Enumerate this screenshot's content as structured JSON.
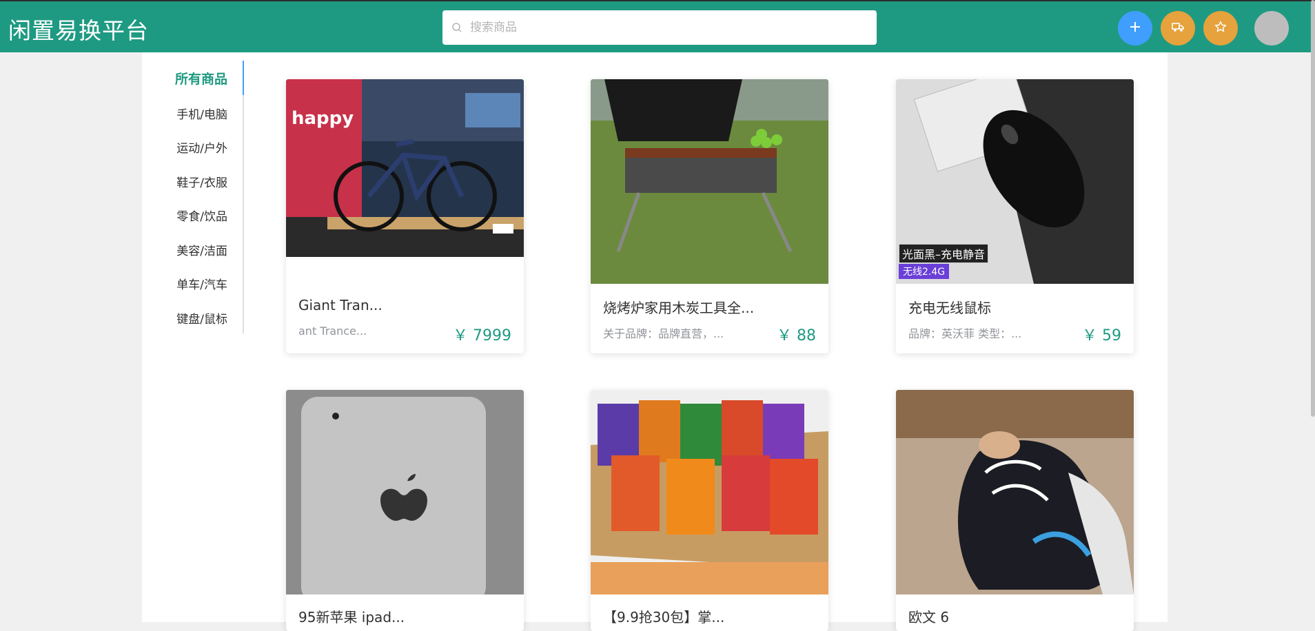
{
  "header": {
    "site_title": "闲置易换平台",
    "search_placeholder": "搜索商品",
    "buttons": [
      {
        "name": "add-item-button",
        "icon": "plus-icon",
        "color": "#409eff"
      },
      {
        "name": "orders-button",
        "icon": "truck-icon",
        "color": "#e6a23c"
      },
      {
        "name": "favorites-button",
        "icon": "star-icon",
        "color": "#e6a23c"
      }
    ],
    "accent_color": "#1f9a82"
  },
  "sidebar": {
    "items": [
      {
        "label": "所有商品",
        "active": true
      },
      {
        "label": "手机/电脑",
        "active": false
      },
      {
        "label": "运动/户外",
        "active": false
      },
      {
        "label": "鞋子/衣服",
        "active": false
      },
      {
        "label": "零食/饮品",
        "active": false
      },
      {
        "label": "美容/洁面",
        "active": false
      },
      {
        "label": "单车/汽车",
        "active": false
      },
      {
        "label": "键盘/鼠标",
        "active": false
      }
    ]
  },
  "products": [
    {
      "title": "Giant Tran...",
      "desc": "ant Trance...",
      "price": "￥ 7999",
      "image": "bicycle-image",
      "overlay_tags": []
    },
    {
      "title": "烧烤炉家用木炭工具全...",
      "desc": "关于品牌：品牌直营，...",
      "price": "￥ 88",
      "image": "bbq-grill-image",
      "overlay_tags": []
    },
    {
      "title": "充电无线鼠标",
      "desc": "品牌：英沃菲 类型：...",
      "price": "￥ 59",
      "image": "wireless-mouse-image",
      "overlay_tags": [
        "光面黑–充电静音",
        "无线2.4G"
      ]
    },
    {
      "title": "95新苹果 ipad...",
      "desc": "",
      "price": "",
      "image": "ipad-image",
      "overlay_tags": []
    },
    {
      "title": "【9.9抢30包】掌...",
      "desc": "",
      "price": "",
      "image": "snack-box-image",
      "overlay_tags": []
    },
    {
      "title": "欧文 6",
      "desc": "",
      "price": "",
      "image": "sneaker-image",
      "overlay_tags": []
    }
  ],
  "image_text": {
    "bike_poster": "happy"
  }
}
